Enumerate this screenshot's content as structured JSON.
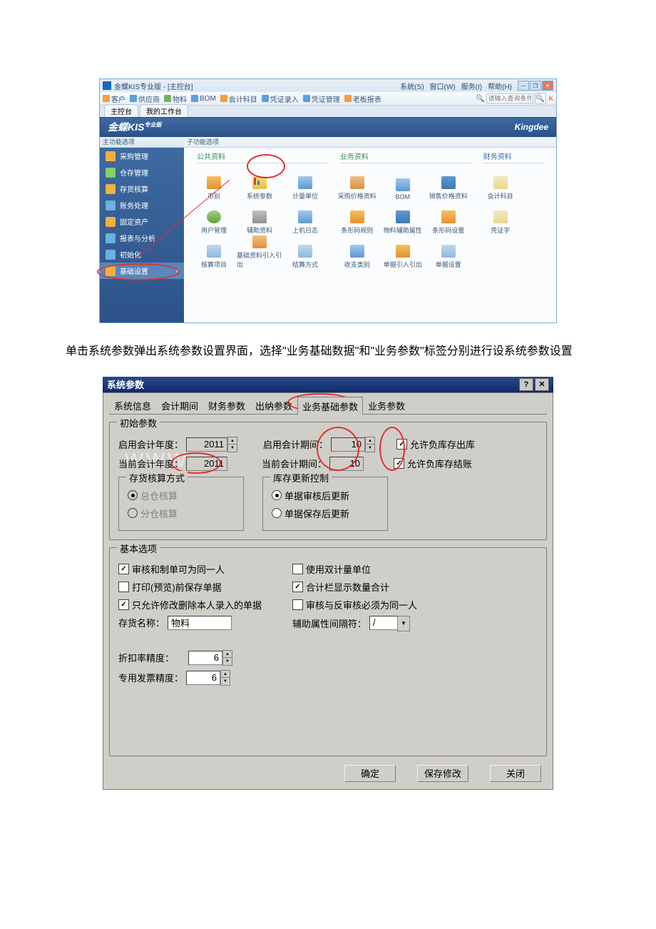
{
  "app1": {
    "title": "金蝶KIS专业版 - [主控台]",
    "menus": [
      "系统(S)",
      "窗口(W)",
      "服务(I)",
      "帮助(H)"
    ],
    "toolbar": [
      "客户",
      "供应商",
      "物料",
      "BOM",
      "会计科目",
      "凭证录入",
      "凭证管理",
      "老板报表"
    ],
    "search_placeholder": "请输入查询条件",
    "tabs": [
      "主控台",
      "我的工作台"
    ],
    "brand": "金蝶KIS",
    "brand_sup": "专业版",
    "kingdee": "Kingdee",
    "side_hdr": "主功能选项",
    "sub_hdr": "子功能选项",
    "side": [
      {
        "label": "采购管理"
      },
      {
        "label": "仓存管理"
      },
      {
        "label": "存货核算"
      },
      {
        "label": "账务处理"
      },
      {
        "label": "固定资产"
      },
      {
        "label": "报表与分析"
      },
      {
        "label": "初始化"
      },
      {
        "label": "基础设置",
        "sel": true
      }
    ],
    "sec_pub": "公共资料",
    "sec_biz": "业务资料",
    "sec_fin": "财务资料",
    "pub_items": [
      "币别",
      "系统参数",
      "计量单位",
      "用户管理",
      "辅助资料",
      "上机日志",
      "核算项目",
      "基础资料引入引出",
      "结算方式"
    ],
    "biz_items": [
      "采购价格资料",
      "BOM",
      "销售价格资料",
      "条形码规则",
      "物料辅助属性",
      "条形码设置",
      "收支类别",
      "单据引入引出",
      "单据设置"
    ],
    "fin_items": [
      "会计科目",
      "凭证字"
    ]
  },
  "bodytext": "单击系统参数弹出系统参数设置界面，选择\"业务基础数据\"和\"业务参数\"标签分别进行设系统参数设置",
  "dlg": {
    "title": "系统参数",
    "tabs": [
      "系统信息",
      "会计期间",
      "财务参数",
      "出纳参数",
      "业务基础参数",
      "业务参数"
    ],
    "grp_init": "初始参数",
    "l_startyear": "启用会计年度：",
    "v_startyear": "2011",
    "l_startperiod": "启用会计期间：",
    "v_startperiod": "10",
    "l_curyear": "当前会计年度：",
    "v_curyear": "2011",
    "l_curperiod": "当前会计期间：",
    "v_curperiod": "10",
    "chk_negout": "允许负库存出库",
    "chk_negclose": "允许负库存结账",
    "grp_cost": "存货核算方式",
    "r_total": "总仓核算",
    "r_split": "分仓核算",
    "grp_stock": "库存更新控制",
    "r_audit": "单据审核后更新",
    "r_save": "单据保存后更新",
    "grp_basic": "基本选项",
    "chk_same": "审核和制单可为同一人",
    "chk_print": "打印(预览)前保存单据",
    "chk_own": "只允许修改删除本人录入的单据",
    "chk_dual": "使用双计量单位",
    "chk_sum": "合计栏显示数量合计",
    "chk_rev": "审核与反审核必须为同一人",
    "l_stockname": "存货名称：",
    "v_stockname": "物料",
    "l_sep": "辅助属性间隔符：",
    "v_sep": "/",
    "l_disc": "折扣率精度：",
    "v_disc": "6",
    "l_inv": "专用发票精度：",
    "v_inv": "6",
    "btn_ok": "确定",
    "btn_save": "保存修改",
    "btn_close": "关闭"
  }
}
